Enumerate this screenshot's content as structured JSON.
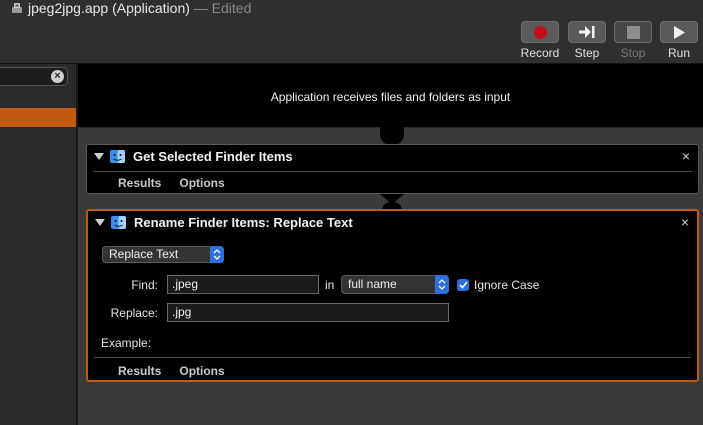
{
  "window": {
    "title": "jpeg2jpg.app (Application)",
    "edited": "— Edited"
  },
  "toolbar": {
    "record": "Record",
    "step": "Step",
    "stop": "Stop",
    "run": "Run",
    "accent": "#c0101a"
  },
  "sidebar": {
    "search_value": "",
    "selected_color": "#c35a13"
  },
  "workflow": {
    "input_text": "Application receives files and folders as input",
    "actions": [
      {
        "name": "Get Selected Finder Items",
        "tabs": [
          "Results",
          "Options"
        ]
      },
      {
        "name": "Rename Finder Items: Replace Text",
        "mode": "Replace Text",
        "find_label": "Find:",
        "find_value": ".jpeg",
        "in_label": "in",
        "scope": "full name",
        "ignore_case_label": "Ignore Case",
        "ignore_case": true,
        "replace_label": "Replace:",
        "replace_value": ".jpg",
        "example_label": "Example:",
        "tabs": [
          "Results",
          "Options"
        ]
      }
    ]
  }
}
